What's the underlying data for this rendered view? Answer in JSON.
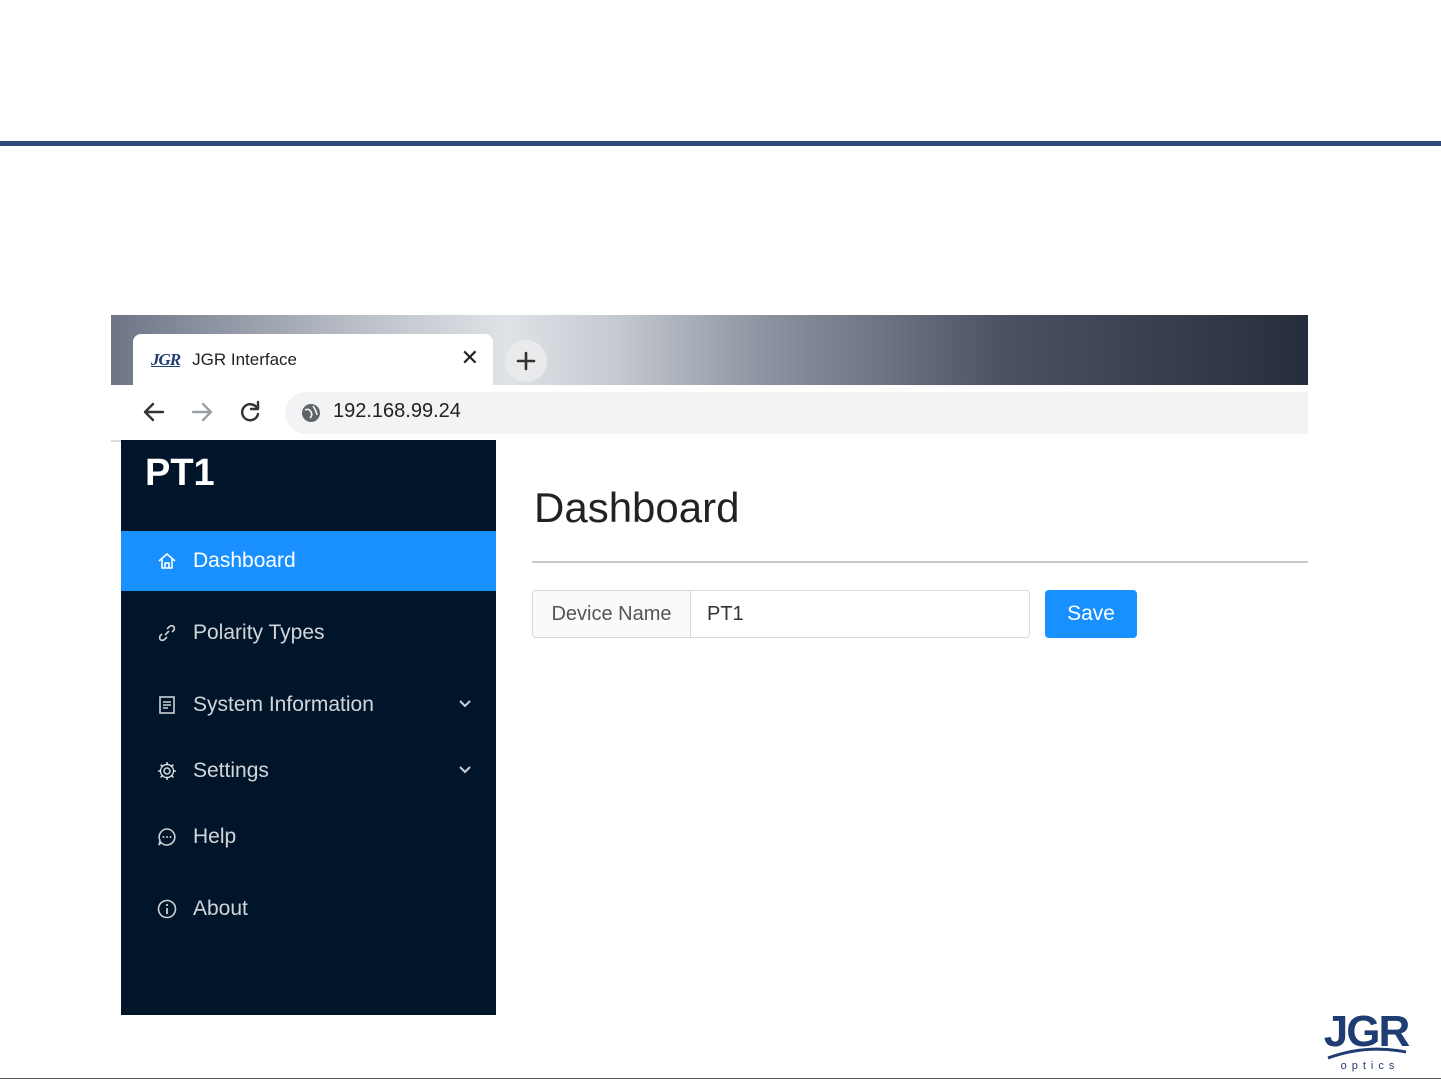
{
  "browser": {
    "tab_title": "JGR Interface",
    "tab_logo_text": "JGR",
    "close_glyph": "✕",
    "address": "192.168.99.24",
    "nav_icons": [
      "back-arrow-icon",
      "forward-arrow-icon",
      "reload-icon",
      "globe-icon",
      "new-tab-plus-icon"
    ],
    "highlight_color": "#e01010"
  },
  "sidebar": {
    "brand": "PT1",
    "items": [
      {
        "label": "Dashboard",
        "icon": "home-icon",
        "active": true
      },
      {
        "label": "Polarity Types",
        "icon": "link-icon"
      },
      {
        "label": "System Information",
        "icon": "document-icon",
        "has_submenu": true
      },
      {
        "label": "Settings",
        "icon": "gear-icon",
        "has_submenu": true
      },
      {
        "label": "Help",
        "icon": "chat-bubble-icon"
      },
      {
        "label": "About",
        "icon": "info-circle-icon"
      }
    ]
  },
  "main": {
    "title": "Dashboard",
    "device_name_label": "Device Name",
    "device_name_value": "PT1",
    "save_label": "Save"
  },
  "branding": {
    "logo_main": "JGR",
    "logo_sub": "optics"
  },
  "colors": {
    "accent": "#1890ff",
    "sidebar_bg": "#001529",
    "slide_rule": "#2e4a7a",
    "logo": "#1f3c73"
  }
}
